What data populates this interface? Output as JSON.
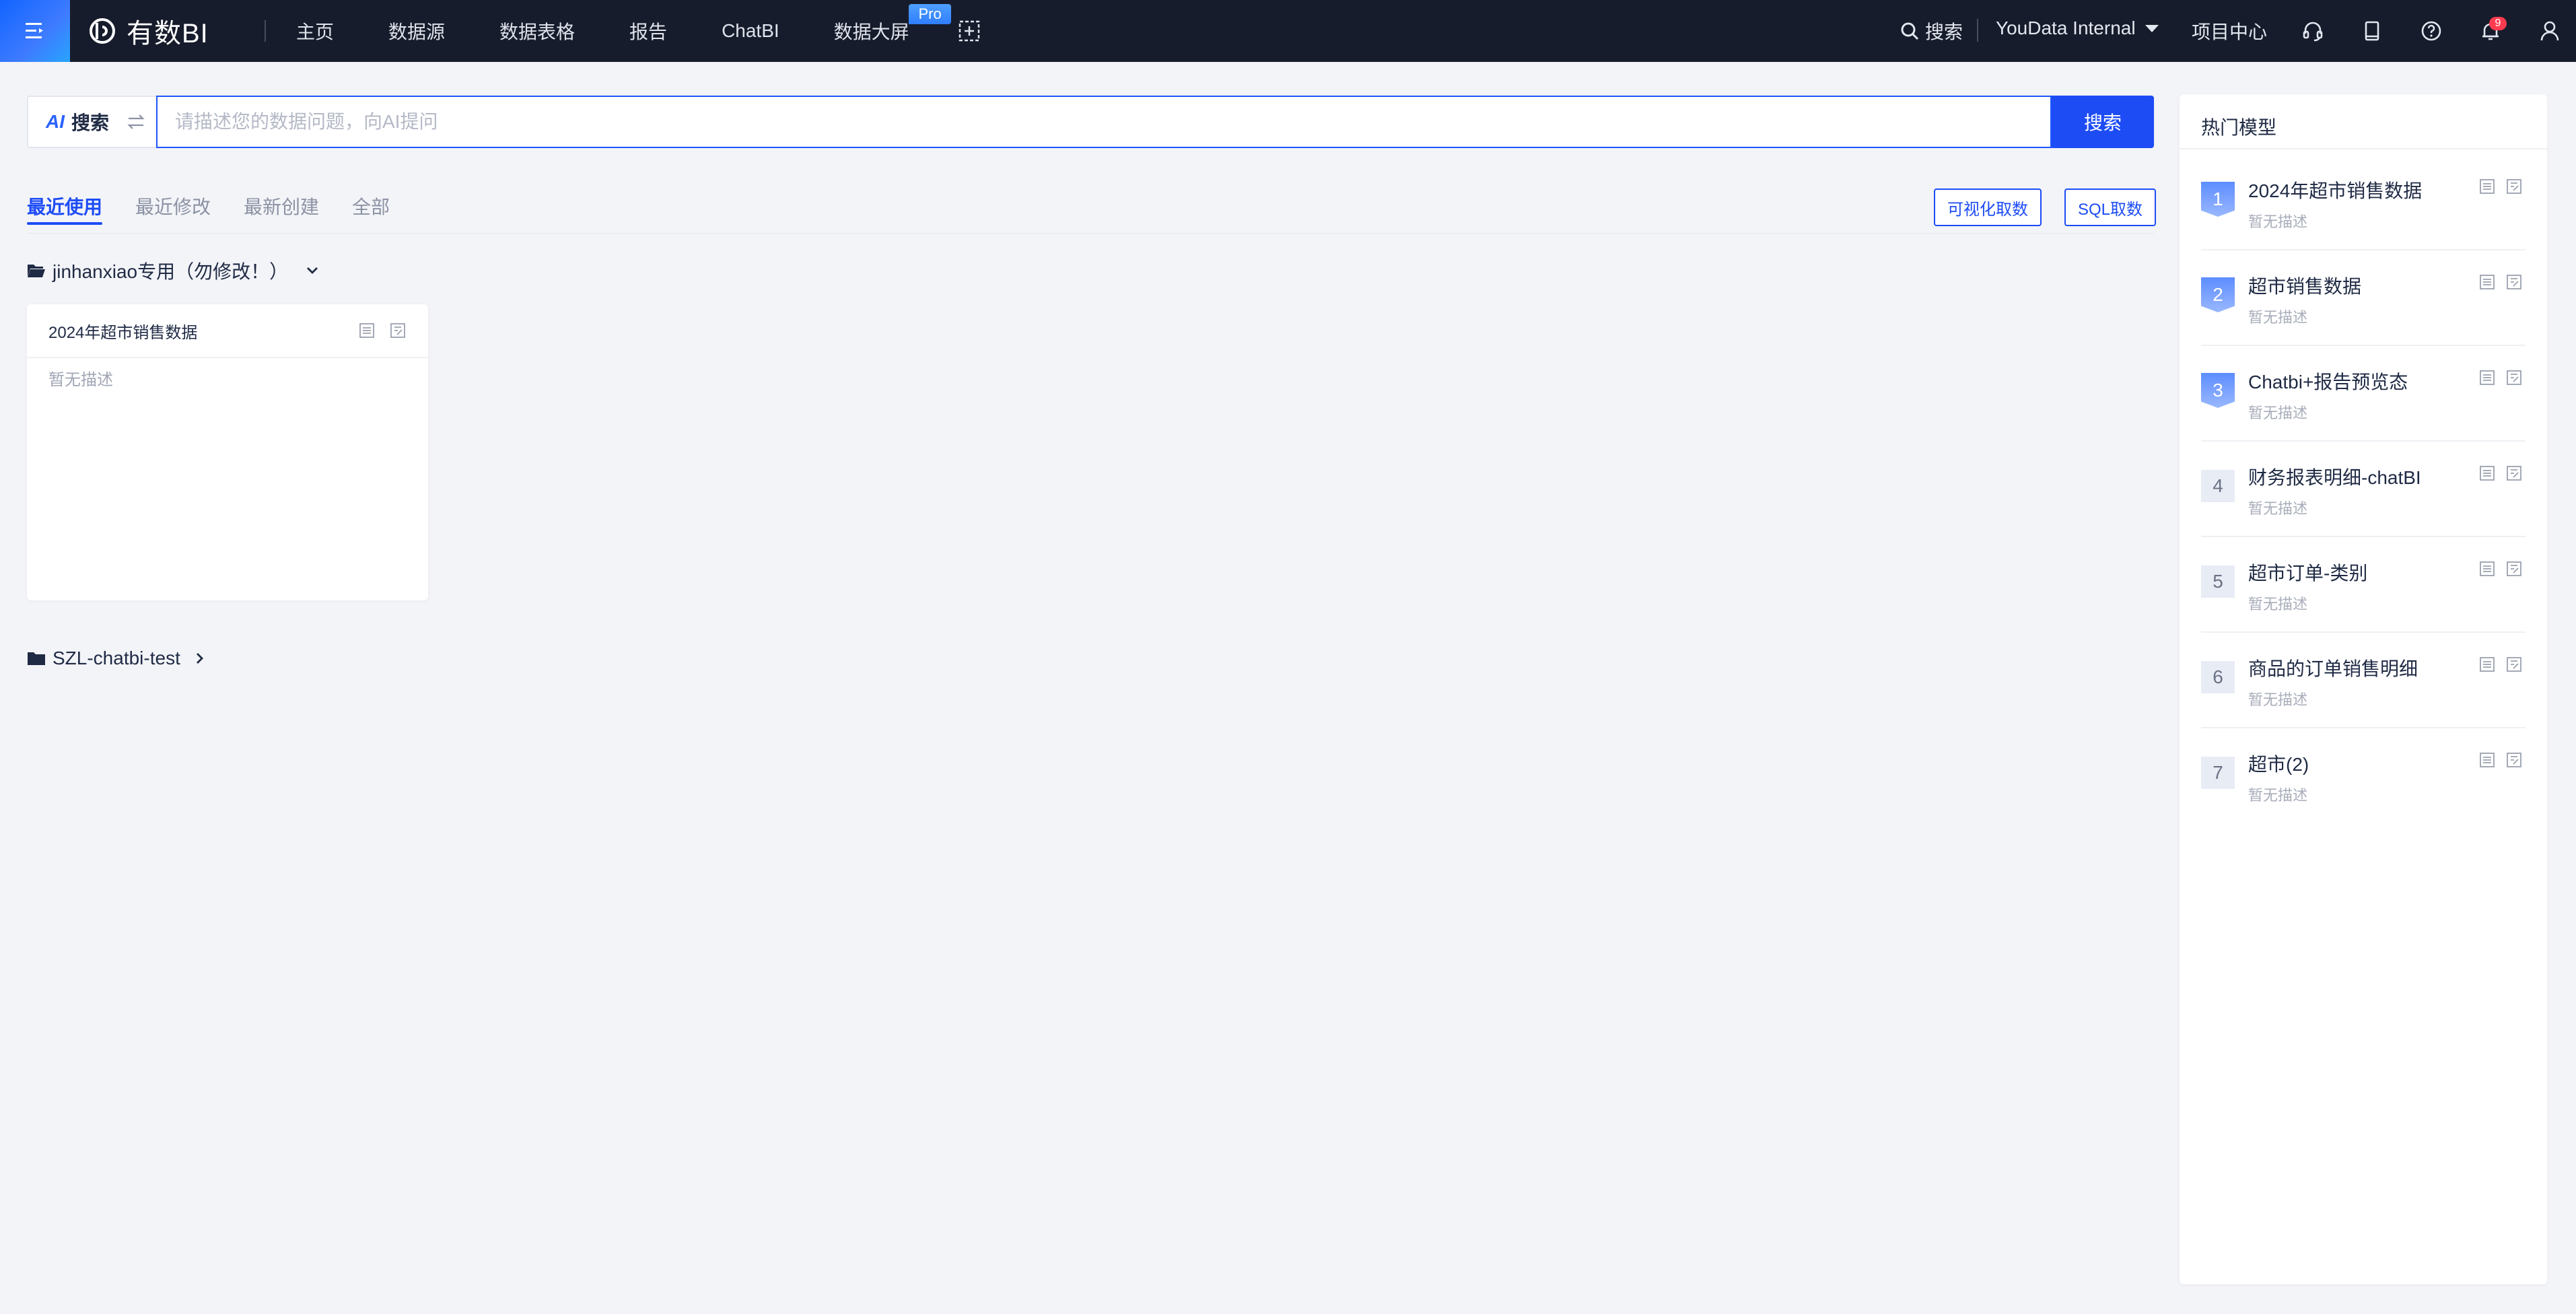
{
  "colors": {
    "topbar": "#171c2c",
    "accent": "#1d4cf5",
    "badge": "#ff3b4f",
    "background": "#f3f4f8"
  },
  "brand": {
    "name": "有数BI"
  },
  "nav": {
    "items": [
      "主页",
      "数据源",
      "数据表格",
      "报告",
      "ChatBI",
      "数据大屏"
    ],
    "pro_badge": "Pro"
  },
  "header": {
    "search_label": "搜索",
    "tenant": "YouData Internal",
    "project_center": "项目中心",
    "notification_count": "9"
  },
  "search": {
    "mode_mark": "AI",
    "mode_label": "搜索",
    "placeholder": "请描述您的数据问题，向AI提问",
    "value": "",
    "button": "搜索"
  },
  "tabs": [
    {
      "label": "最近使用",
      "active": true
    },
    {
      "label": "最近修改",
      "active": false
    },
    {
      "label": "最新创建",
      "active": false
    },
    {
      "label": "全部",
      "active": false
    }
  ],
  "actions": {
    "visual_query": "可视化取数",
    "sql_query": "SQL取数"
  },
  "folders": [
    {
      "name": "jinhanxiao专用（勿修改！）",
      "expanded": true,
      "cards": [
        {
          "title": "2024年超市销售数据",
          "desc": "暂无描述"
        }
      ]
    },
    {
      "name": "SZL-chatbi-test",
      "expanded": false,
      "cards": []
    }
  ],
  "hot_models": {
    "title": "热门模型",
    "items": [
      {
        "rank": "1",
        "name": "2024年超市销售数据",
        "desc": "暂无描述"
      },
      {
        "rank": "2",
        "name": "超市销售数据",
        "desc": "暂无描述"
      },
      {
        "rank": "3",
        "name": "Chatbi+报告预览态",
        "desc": "暂无描述"
      },
      {
        "rank": "4",
        "name": "财务报表明细-chatBI",
        "desc": "暂无描述"
      },
      {
        "rank": "5",
        "name": "超市订单-类别",
        "desc": "暂无描述"
      },
      {
        "rank": "6",
        "name": "商品的订单销售明细",
        "desc": "暂无描述"
      },
      {
        "rank": "7",
        "name": "超市(2)",
        "desc": "暂无描述"
      }
    ]
  }
}
